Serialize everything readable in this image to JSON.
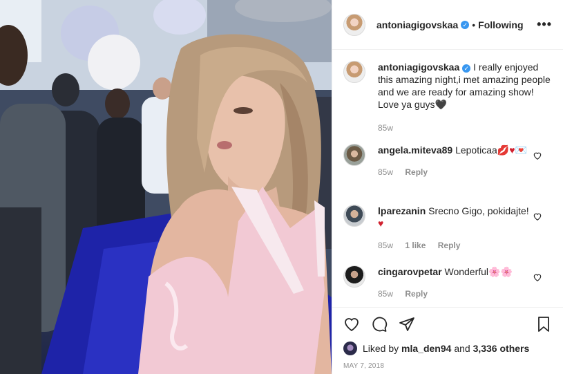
{
  "post": {
    "username": "antoniagigovskaa",
    "separator": "•",
    "follow_status": "Following",
    "more_label": "•••"
  },
  "caption": {
    "username": "antoniagigovskaa",
    "text_line1": "I really enjoyed this amazing night,i met amazing people and we are ready for amazing show!",
    "text_line2": "Love ya guys",
    "emoji": "🖤",
    "time": "85w"
  },
  "comments": [
    {
      "username": "angela.miteva89",
      "text": "Lepoticaa",
      "emojis": "💋♥💌",
      "time": "85w",
      "likes": "",
      "reply": "Reply"
    },
    {
      "username": "lparezanin",
      "text": "Srecno Gigo, pokidajte!",
      "emojis": "♥",
      "time": "85w",
      "likes": "1 like",
      "reply": "Reply"
    },
    {
      "username": "cingarovpetar",
      "text": "Wonderful",
      "emojis": "🌸🌸",
      "time": "85w",
      "likes": "",
      "reply": "Reply"
    }
  ],
  "likes": {
    "prefix": "Liked by",
    "user": "mla_den94",
    "conj": "and",
    "count": "3,336 others"
  },
  "date": "MAY 7, 2018",
  "icons": [
    "heart-icon",
    "comment-icon",
    "share-icon",
    "bookmark-icon"
  ]
}
